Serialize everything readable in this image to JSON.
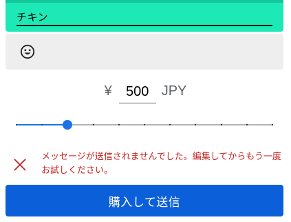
{
  "message_block": {
    "text": "チキン",
    "background": "#1de9b6"
  },
  "emoji_picker": {
    "icon": "smiling-face-icon"
  },
  "price": {
    "currency_symbol": "¥",
    "amount": "500",
    "currency_code": "JPY"
  },
  "slider": {
    "steps": 10,
    "value_step": 2,
    "accent": "#1a73e8"
  },
  "error": {
    "icon": "close-x-icon",
    "message": "メッセージが送信されませんでした。編集してからもう一度お試しください。",
    "color": "#c5221f"
  },
  "buy_button": {
    "label": "購入して送信",
    "color": "#0b5fd9"
  }
}
